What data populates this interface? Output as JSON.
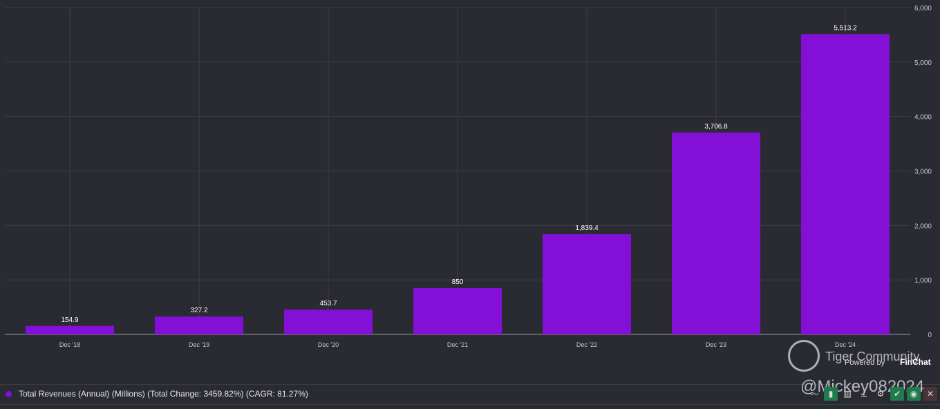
{
  "chart_data": {
    "type": "bar",
    "categories": [
      "Dec '18",
      "Dec '19",
      "Dec '20",
      "Dec '21",
      "Dec '22",
      "Dec '23",
      "Dec '24"
    ],
    "values": [
      154.9,
      327.2,
      453.7,
      850,
      1839.4,
      3706.8,
      5513.2
    ],
    "value_labels": [
      "154.9",
      "327.2",
      "453.7",
      "850",
      "1,839.4",
      "3,706.8",
      "5,513.2"
    ],
    "ylim": [
      0,
      6000
    ],
    "yticks": [
      0,
      1000,
      2000,
      3000,
      4000,
      5000,
      6000
    ],
    "ytick_labels": [
      "0",
      "1,000",
      "2,000",
      "3,000",
      "4,000",
      "5,000",
      "6,000"
    ],
    "y_axis_position": "right",
    "grid": true,
    "bar_color": "#8410d8",
    "legend": {
      "label": "Total Revenues (Annual) (Millions) (Total Change: 3459.82%) (CAGR: 81.27%)",
      "placement": "bottom-left"
    }
  },
  "watermark": {
    "brand": "Tiger Community",
    "powered": "Powered by",
    "finchat": "FinChat",
    "user": "@Mickey082024"
  },
  "toolbar": {
    "icons": [
      "line-chart-icon",
      "bar-chart-icon",
      "stacked-bar-icon",
      "data-label-icon",
      "gear-icon",
      "check-icon",
      "eye-icon",
      "close-icon"
    ]
  }
}
